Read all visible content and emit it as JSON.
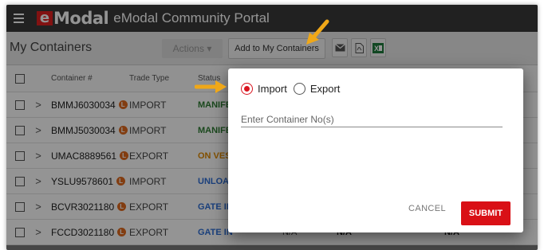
{
  "header": {
    "logo_mark": "e",
    "logo_word": "Modal",
    "portal_title": "eModal Community Portal"
  },
  "toolbar": {
    "page_title": "My Containers",
    "actions_label": "Actions",
    "add_label": "Add to My Containers"
  },
  "table": {
    "columns": [
      "Container #",
      "Trade Type",
      "Status"
    ],
    "rows": [
      {
        "container": "BMMJ6030034",
        "trade": "IMPORT",
        "status": "MANIFE",
        "status_color": "#2e7d32",
        "c4": "",
        "c5": "",
        "c6": ""
      },
      {
        "container": "BMMJ5030034",
        "trade": "IMPORT",
        "status": "MANIFE",
        "status_color": "#2e7d32",
        "c4": "",
        "c5": "",
        "c6": ""
      },
      {
        "container": "UMAC8889561",
        "trade": "EXPORT",
        "status": "ON VES",
        "status_color": "#e08a00",
        "c4": "",
        "c5": "",
        "c6": ""
      },
      {
        "container": "YSLU9578601",
        "trade": "IMPORT",
        "status": "UNLOAD",
        "status_color": "#2f6fd6",
        "c4": "",
        "c5": "",
        "c6": ""
      },
      {
        "container": "BCVR3021180",
        "trade": "EXPORT",
        "status": "GATE IN",
        "status_color": "#2f6fd6",
        "c4": "",
        "c5": "",
        "c6": ""
      },
      {
        "container": "FCCD3021180",
        "trade": "EXPORT",
        "status": "GATE IN",
        "status_color": "#2f6fd6",
        "c4": "N/A",
        "c5": "N/A",
        "c6": "N/A"
      }
    ],
    "badge_label": "L"
  },
  "modal": {
    "import_label": "Import",
    "export_label": "Export",
    "selected": "Import",
    "placeholder": "Enter Container No(s)",
    "cancel_label": "CANCEL",
    "submit_label": "SUBMIT"
  },
  "colors": {
    "accent": "#d9131e",
    "arrow": "#f0a818"
  }
}
